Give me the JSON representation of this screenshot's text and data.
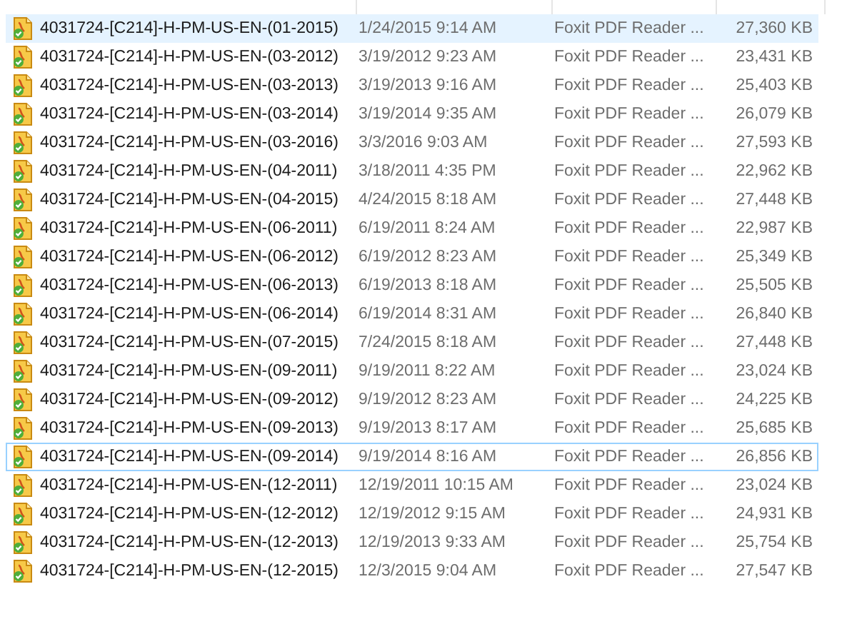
{
  "files": [
    {
      "name": "4031724-[C214]-H-PM-US-EN-(01-2015)",
      "date": "1/24/2015 9:14 AM",
      "type": "Foxit PDF Reader ...",
      "size": "27,360 KB",
      "hovered": true,
      "focused": false
    },
    {
      "name": "4031724-[C214]-H-PM-US-EN-(03-2012)",
      "date": "3/19/2012 9:23 AM",
      "type": "Foxit PDF Reader ...",
      "size": "23,431 KB",
      "hovered": false,
      "focused": false
    },
    {
      "name": "4031724-[C214]-H-PM-US-EN-(03-2013)",
      "date": "3/19/2013 9:16 AM",
      "type": "Foxit PDF Reader ...",
      "size": "25,403 KB",
      "hovered": false,
      "focused": false
    },
    {
      "name": "4031724-[C214]-H-PM-US-EN-(03-2014)",
      "date": "3/19/2014 9:35 AM",
      "type": "Foxit PDF Reader ...",
      "size": "26,079 KB",
      "hovered": false,
      "focused": false
    },
    {
      "name": "4031724-[C214]-H-PM-US-EN-(03-2016)",
      "date": "3/3/2016 9:03 AM",
      "type": "Foxit PDF Reader ...",
      "size": "27,593 KB",
      "hovered": false,
      "focused": false
    },
    {
      "name": "4031724-[C214]-H-PM-US-EN-(04-2011)",
      "date": "3/18/2011 4:35 PM",
      "type": "Foxit PDF Reader ...",
      "size": "22,962 KB",
      "hovered": false,
      "focused": false
    },
    {
      "name": "4031724-[C214]-H-PM-US-EN-(04-2015)",
      "date": "4/24/2015 8:18 AM",
      "type": "Foxit PDF Reader ...",
      "size": "27,448 KB",
      "hovered": false,
      "focused": false
    },
    {
      "name": "4031724-[C214]-H-PM-US-EN-(06-2011)",
      "date": "6/19/2011 8:24 AM",
      "type": "Foxit PDF Reader ...",
      "size": "22,987 KB",
      "hovered": false,
      "focused": false
    },
    {
      "name": "4031724-[C214]-H-PM-US-EN-(06-2012)",
      "date": "6/19/2012 8:23 AM",
      "type": "Foxit PDF Reader ...",
      "size": "25,349 KB",
      "hovered": false,
      "focused": false
    },
    {
      "name": "4031724-[C214]-H-PM-US-EN-(06-2013)",
      "date": "6/19/2013 8:18 AM",
      "type": "Foxit PDF Reader ...",
      "size": "25,505 KB",
      "hovered": false,
      "focused": false
    },
    {
      "name": "4031724-[C214]-H-PM-US-EN-(06-2014)",
      "date": "6/19/2014 8:31 AM",
      "type": "Foxit PDF Reader ...",
      "size": "26,840 KB",
      "hovered": false,
      "focused": false
    },
    {
      "name": "4031724-[C214]-H-PM-US-EN-(07-2015)",
      "date": "7/24/2015 8:18 AM",
      "type": "Foxit PDF Reader ...",
      "size": "27,448 KB",
      "hovered": false,
      "focused": false
    },
    {
      "name": "4031724-[C214]-H-PM-US-EN-(09-2011)",
      "date": "9/19/2011 8:22 AM",
      "type": "Foxit PDF Reader ...",
      "size": "23,024 KB",
      "hovered": false,
      "focused": false
    },
    {
      "name": "4031724-[C214]-H-PM-US-EN-(09-2012)",
      "date": "9/19/2012 8:23 AM",
      "type": "Foxit PDF Reader ...",
      "size": "24,225 KB",
      "hovered": false,
      "focused": false
    },
    {
      "name": "4031724-[C214]-H-PM-US-EN-(09-2013)",
      "date": "9/19/2013 8:17 AM",
      "type": "Foxit PDF Reader ...",
      "size": "25,685 KB",
      "hovered": false,
      "focused": false
    },
    {
      "name": "4031724-[C214]-H-PM-US-EN-(09-2014)",
      "date": "9/19/2014 8:16 AM",
      "type": "Foxit PDF Reader ...",
      "size": "26,856 KB",
      "hovered": false,
      "focused": true
    },
    {
      "name": "4031724-[C214]-H-PM-US-EN-(12-2011)",
      "date": "12/19/2011 10:15 AM",
      "type": "Foxit PDF Reader ...",
      "size": "23,024 KB",
      "hovered": false,
      "focused": false
    },
    {
      "name": "4031724-[C214]-H-PM-US-EN-(12-2012)",
      "date": "12/19/2012 9:15 AM",
      "type": "Foxit PDF Reader ...",
      "size": "24,931 KB",
      "hovered": false,
      "focused": false
    },
    {
      "name": "4031724-[C214]-H-PM-US-EN-(12-2013)",
      "date": "12/19/2013 9:33 AM",
      "type": "Foxit PDF Reader ...",
      "size": "25,754 KB",
      "hovered": false,
      "focused": false
    },
    {
      "name": "4031724-[C214]-H-PM-US-EN-(12-2015)",
      "date": "12/3/2015 9:04 AM",
      "type": "Foxit PDF Reader ...",
      "size": "27,547 KB",
      "hovered": false,
      "focused": false
    }
  ]
}
